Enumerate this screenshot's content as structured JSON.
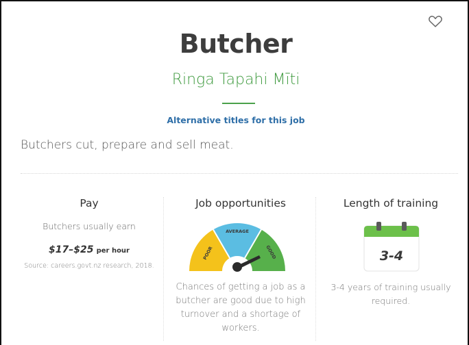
{
  "title": "Butcher",
  "maori_title": "Ringa Tapahi Mīti",
  "alt_titles_link": "Alternative titles for this job",
  "description": "Butchers cut, prepare and sell meat.",
  "pay": {
    "heading": "Pay",
    "subtitle": "Butchers usually earn",
    "amount": "$17–$25",
    "unit": "per hour",
    "source": "Source: careers.govt.nz research, 2018."
  },
  "job_opportunities": {
    "heading": "Job opportunities",
    "gauge": {
      "labels": [
        "POOR",
        "AVERAGE",
        "GOOD"
      ],
      "colors": [
        "#f4c21b",
        "#5bbde2",
        "#57b04b"
      ],
      "needle_value": "good"
    },
    "text": "Chances of getting a job as a butcher are good due to high turnover and a shortage of workers."
  },
  "training": {
    "heading": "Length of training",
    "calendar_value": "3-4",
    "calendar_color": "#6cc04a",
    "text": "3-4 years of training usually required."
  },
  "icons": {
    "favourite": "heart-outline-icon",
    "calendar": "calendar-icon",
    "gauge": "gauge-icon"
  }
}
